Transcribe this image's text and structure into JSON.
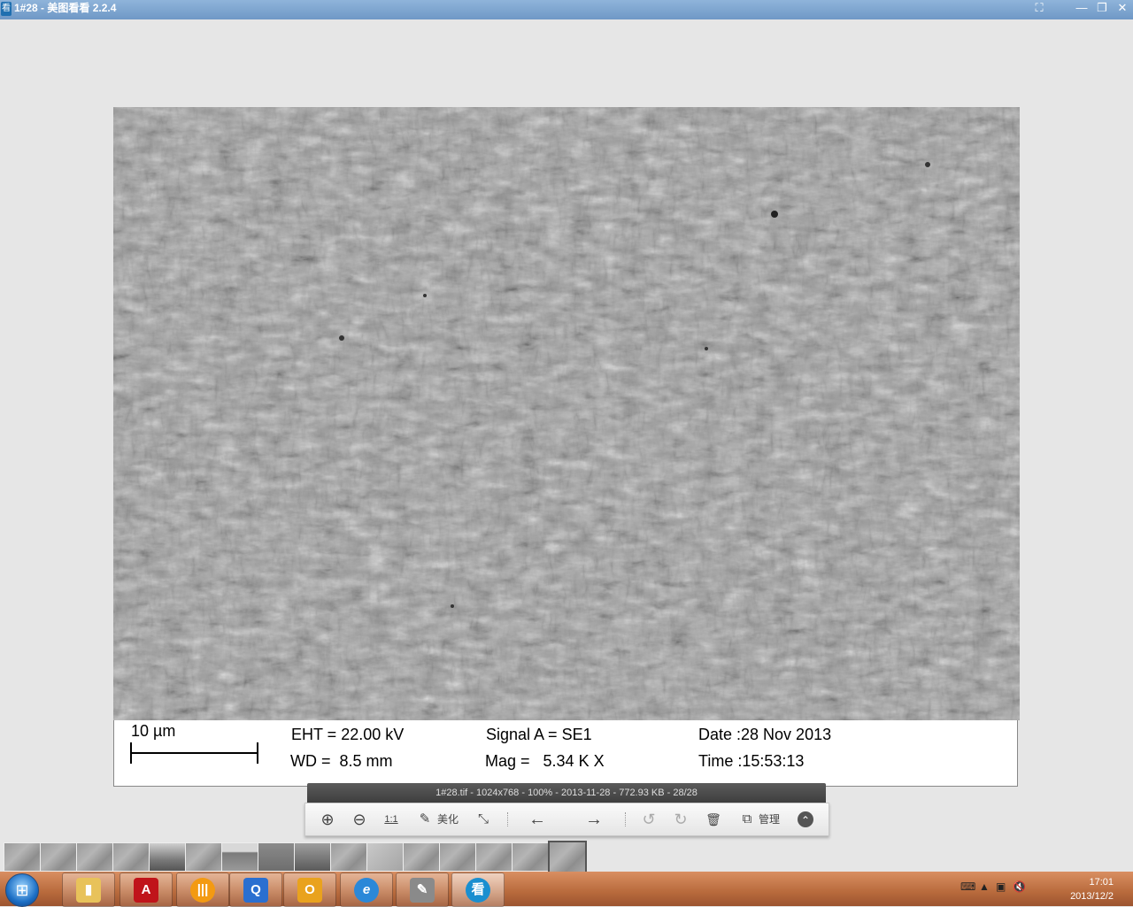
{
  "window": {
    "title": "1#28 - 美图看看 2.2.4",
    "app_icon_glyph": "看",
    "buttons": {
      "fullscreen_icon": "fullscreen-icon",
      "minimize_icon": "minimize-icon",
      "restore_icon": "restore-icon",
      "close_icon": "close-icon",
      "fullscreen": "⛶",
      "minimize": "—",
      "restore": "❐",
      "close": "✕"
    }
  },
  "sem_info": {
    "scale_label": "10 µm",
    "eht": "EHT = 22.00 kV",
    "wd": "WD =  8.5 mm",
    "signal": "Signal A = SE1",
    "mag": "Mag =   5.34 K X",
    "date": "Date :28 Nov 2013",
    "time": "Time :15:53:13"
  },
  "file_info": "1#28.tif - 1024x768 - 100% - 2013-11-28 - 772.93 KB - 28/28",
  "toolbar": {
    "zoom_in": "⊕",
    "zoom_out": "⊖",
    "actual_size": "1:1",
    "beautify_icon": "✎",
    "beautify": "美化",
    "fit": "⤡",
    "prev": "←",
    "next": "→",
    "rotate_left": "↺",
    "rotate_right": "↻",
    "delete": "🗑",
    "manage_icon": "⧉",
    "manage": "管理",
    "collapse": "⌃"
  },
  "taskbar": {
    "start": "⊞",
    "apps": [
      {
        "name": "explorer",
        "glyph": "▮",
        "color": "#e8c25a"
      },
      {
        "name": "acrobat",
        "glyph": "A",
        "color": "#c0141a"
      },
      {
        "name": "app-orange",
        "glyph": "|||",
        "color": "#f39a12"
      },
      {
        "name": "app-blue",
        "glyph": "Q",
        "color": "#2a6fd0"
      },
      {
        "name": "outlook",
        "glyph": "O",
        "color": "#e9a21e"
      },
      {
        "name": "internet-explorer",
        "glyph": "e",
        "color": "#2b88d8"
      },
      {
        "name": "paint",
        "glyph": "✎",
        "color": "#8a8a8a"
      },
      {
        "name": "meitu-viewer",
        "glyph": "看",
        "color": "#1a8fd0"
      }
    ],
    "tray_icons": [
      "keyboard-icon",
      "network-icon",
      "volume-muted-icon"
    ],
    "time": "17:01",
    "date": "2013/12/2"
  }
}
